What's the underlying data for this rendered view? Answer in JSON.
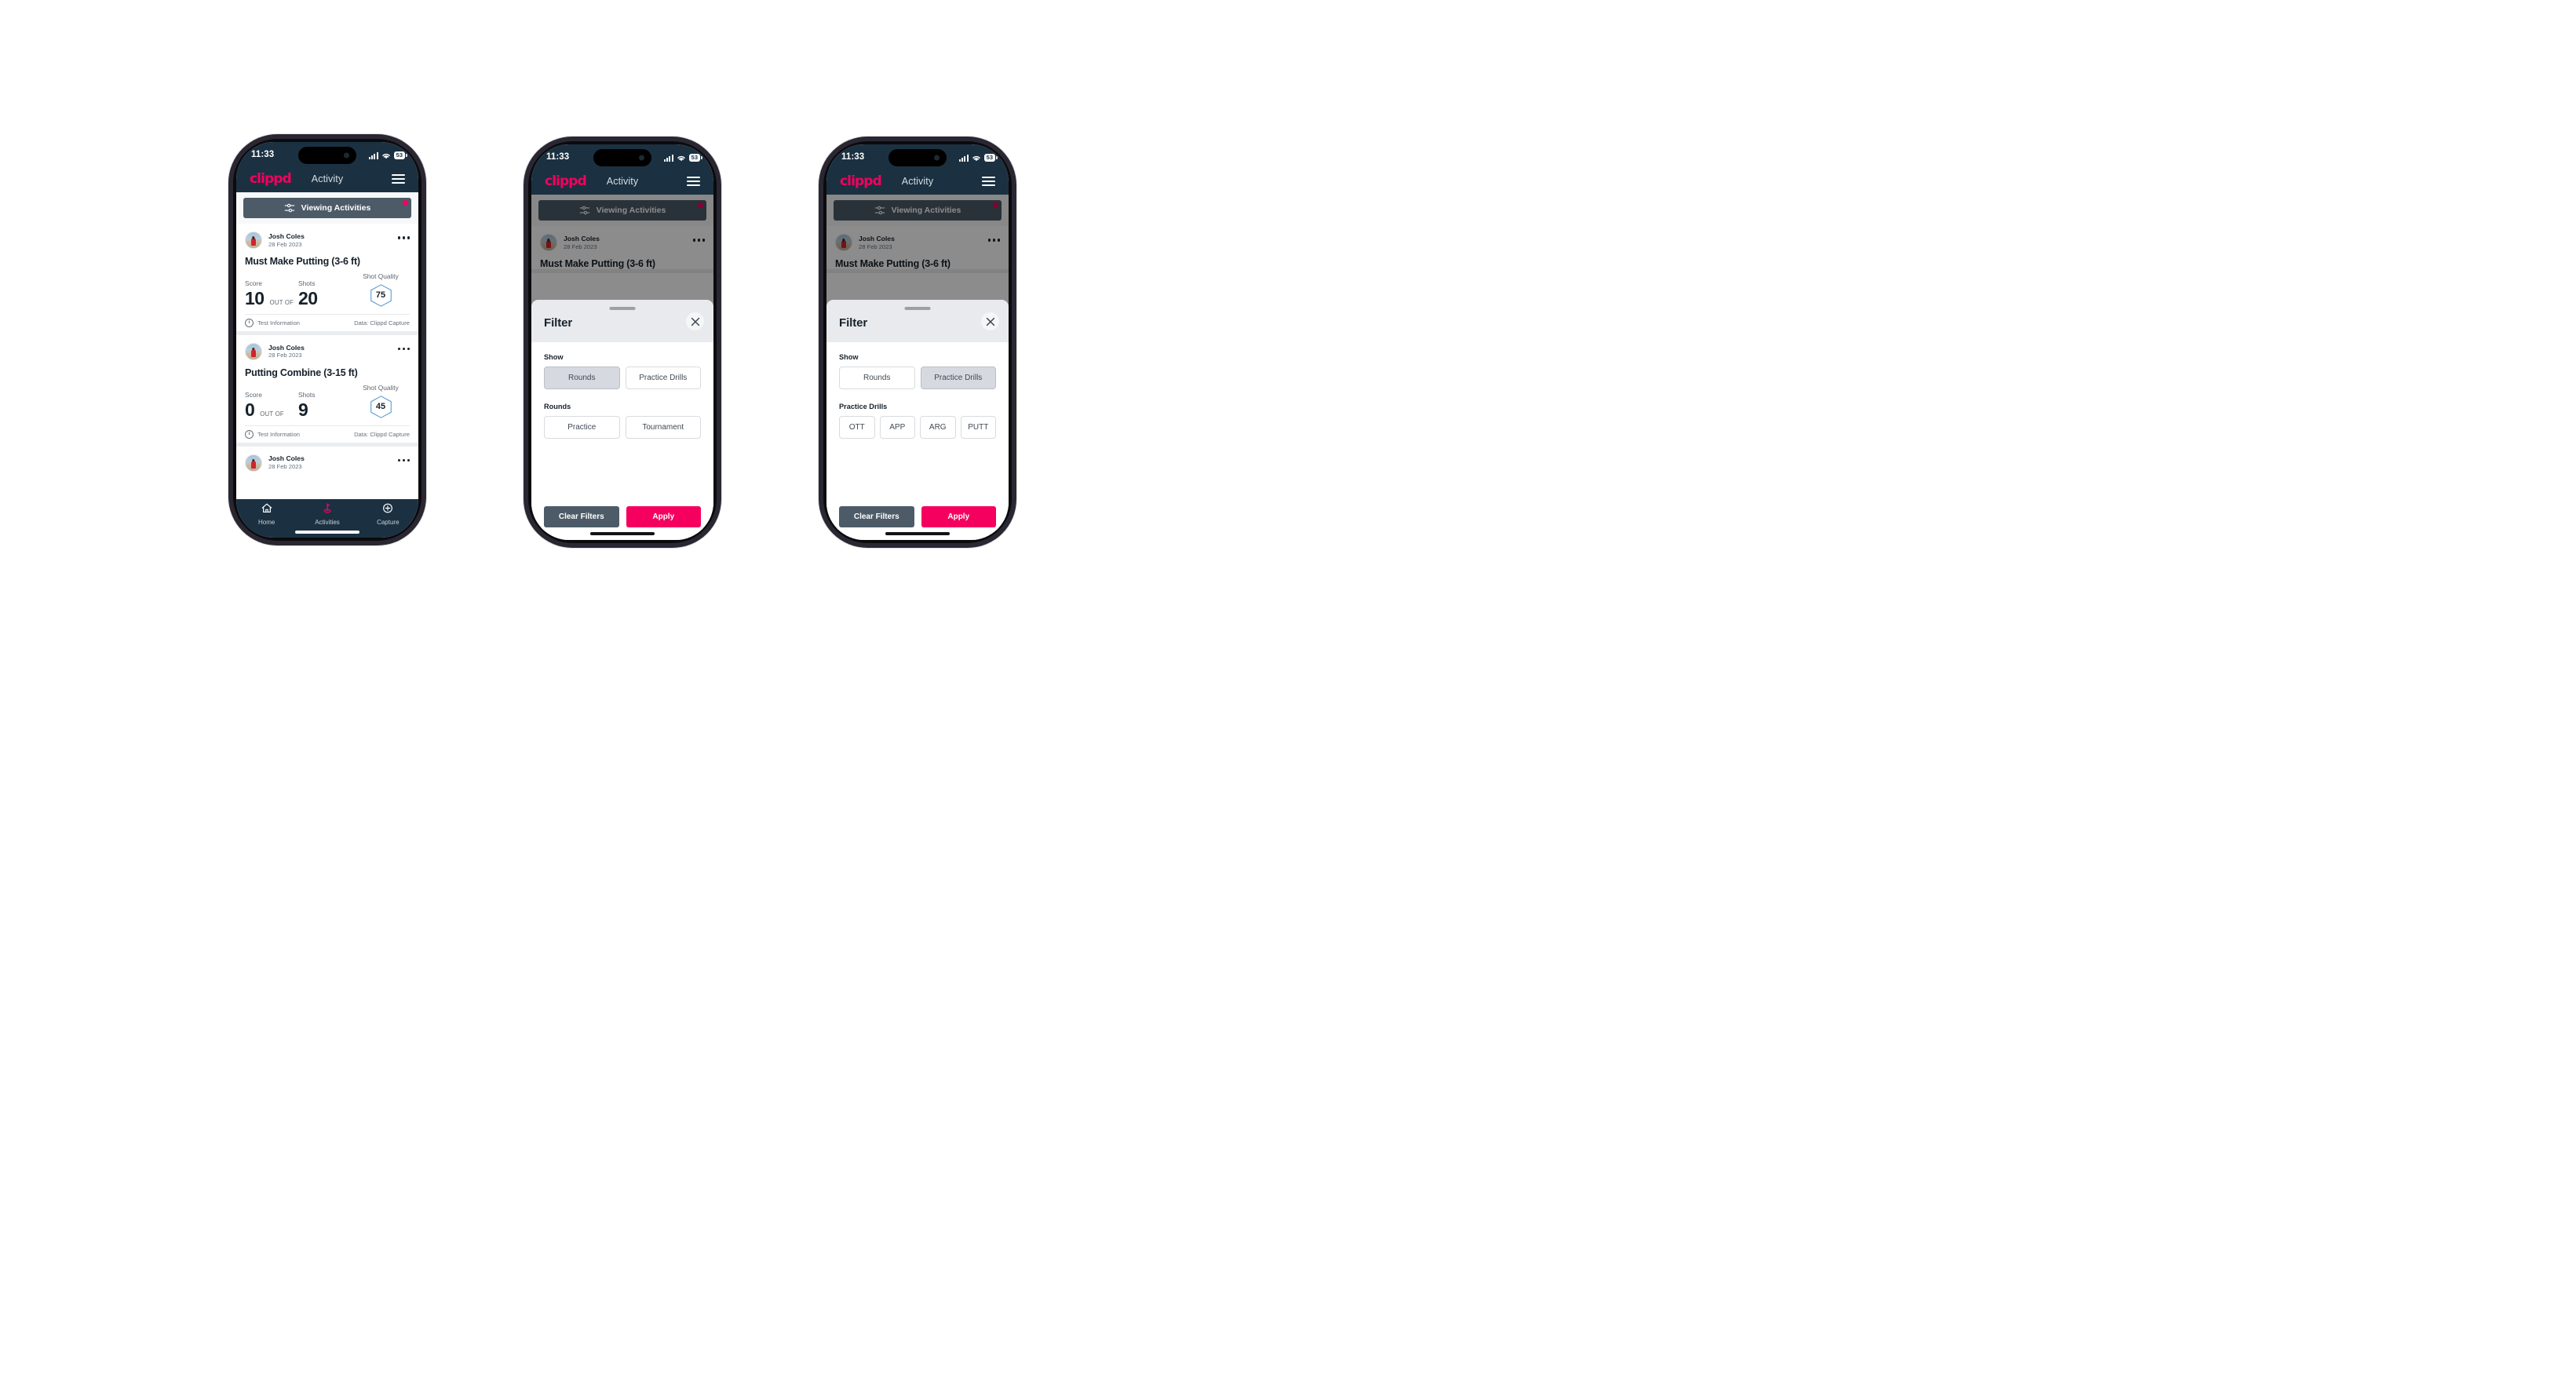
{
  "statusbar": {
    "time": "11:33",
    "battery": "53",
    "signal_icon": "cellular-signal-icon",
    "wifi_icon": "wifi-icon",
    "battery_icon": "battery-icon"
  },
  "appbar": {
    "logo": "clippd",
    "title": "Activity",
    "menu_icon": "hamburger-menu-icon"
  },
  "filterbar": {
    "label": "Viewing Activities",
    "icon": "sliders-filter-icon",
    "has_notification_dot": true
  },
  "activities": [
    {
      "author": "Josh Coles",
      "date": "28 Feb 2023",
      "title": "Must Make Putting (3-6 ft)",
      "score_label": "Score",
      "score_value": "10",
      "out_of_label": "OUT OF",
      "shots_label": "Shots",
      "shots_value": "20",
      "shot_quality_label": "Shot Quality",
      "shot_quality_value": "75",
      "footer_left": "Test Information",
      "footer_right": "Data: Clippd Capture",
      "menu_icon": "kebab-menu-icon",
      "info_icon": "info-circle-icon"
    },
    {
      "author": "Josh Coles",
      "date": "28 Feb 2023",
      "title": "Putting Combine (3-15 ft)",
      "score_label": "Score",
      "score_value": "0",
      "out_of_label": "OUT OF",
      "shots_label": "Shots",
      "shots_value": "9",
      "shot_quality_label": "Shot Quality",
      "shot_quality_value": "45",
      "footer_left": "Test Information",
      "footer_right": "Data: Clippd Capture",
      "menu_icon": "kebab-menu-icon",
      "info_icon": "info-circle-icon"
    },
    {
      "author": "Josh Coles",
      "date": "28 Feb 2023",
      "menu_icon": "kebab-menu-icon"
    }
  ],
  "bottomnav": {
    "items": [
      {
        "label": "Home",
        "icon": "home-icon",
        "active": false
      },
      {
        "label": "Activities",
        "icon": "golf-flag-icon",
        "active": true
      },
      {
        "label": "Capture",
        "icon": "plus-circle-icon",
        "active": false
      }
    ]
  },
  "filter_sheet": {
    "title": "Filter",
    "close_icon": "close-x-icon",
    "grabber": "drag-handle",
    "show_label": "Show",
    "show_options": [
      "Rounds",
      "Practice Drills"
    ],
    "rounds_label": "Rounds",
    "rounds_options": [
      "Practice",
      "Tournament"
    ],
    "practice_drills_label": "Practice Drills",
    "practice_drills_options": [
      "OTT",
      "APP",
      "ARG",
      "PUTT"
    ],
    "clear_label": "Clear Filters",
    "apply_label": "Apply"
  },
  "phone2_state": {
    "show_selected": "Rounds"
  },
  "phone3_state": {
    "show_selected": "Practice Drills"
  },
  "colors": {
    "brand_pink": "#f5005e",
    "header_navy": "#1b3142",
    "slate": "#4d5b68",
    "hex_blue": "#5b9bd5"
  }
}
